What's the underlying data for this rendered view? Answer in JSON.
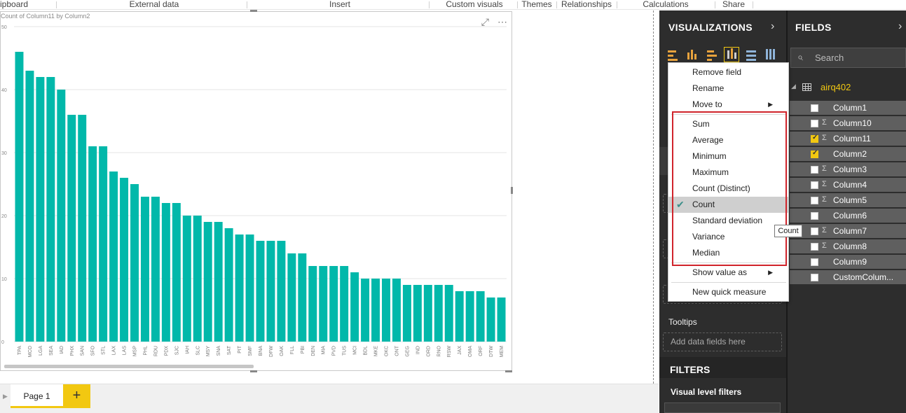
{
  "ribbon": {
    "groups": [
      "ipboard",
      "External data",
      "Insert",
      "Custom visuals",
      "Themes",
      "Relationships",
      "Calculations",
      "Share"
    ]
  },
  "visual": {
    "title": "Count of Column11 by Column2",
    "icons": [
      "focus-mode-icon",
      "more-options-icon"
    ]
  },
  "chart_data": {
    "type": "bar",
    "title": "Count of Column11 by Column2",
    "xlabel": "",
    "ylabel": "",
    "ylim": [
      0,
      50
    ],
    "yticks": [
      0,
      10,
      20,
      30,
      40,
      50
    ],
    "grid": true,
    "color": "#01b8aa",
    "categories": [
      "TPA",
      "MCO",
      "LGA",
      "SEA",
      "IAD",
      "PHX",
      "SAN",
      "SFO",
      "STL",
      "LAX",
      "LAS",
      "MSP",
      "PHL",
      "RDU",
      "PDX",
      "SJC",
      "IAH",
      "SLC",
      "MSY",
      "SNA",
      "SAT",
      "PIT",
      "SMF",
      "BNA",
      "DFW",
      "OAK",
      "FLL",
      "PBI",
      "DEN",
      "MIA",
      "PVD",
      "TUS",
      "MCI",
      "BDL",
      "MKE",
      "OKC",
      "ONT",
      "GEG",
      "IND",
      "ORD",
      "RNO",
      "RSW",
      "JAX",
      "OMA",
      "ORF",
      "DTW",
      "MEM"
    ],
    "values": [
      46,
      43,
      42,
      42,
      40,
      36,
      36,
      31,
      31,
      27,
      26,
      25,
      23,
      23,
      22,
      22,
      20,
      20,
      19,
      19,
      18,
      17,
      17,
      16,
      16,
      16,
      14,
      14,
      12,
      12,
      12,
      12,
      11,
      10,
      10,
      10,
      10,
      9,
      9,
      9,
      9,
      9,
      8,
      8,
      8,
      7,
      7
    ]
  },
  "pages": {
    "current": "Page 1",
    "add_label": "+"
  },
  "viz_pane": {
    "title": "VISUALIZATIONS",
    "tooltips_label": "Tooltips",
    "tooltips_placeholder": "Add data fields here",
    "filters_title": "FILTERS",
    "visual_level_filters": "Visual level filters"
  },
  "fields_pane": {
    "title": "FIELDS",
    "search_placeholder": "Search",
    "table_name": "airq402",
    "fields": [
      {
        "name": "Column1",
        "sigma": false,
        "checked": false
      },
      {
        "name": "Column10",
        "sigma": true,
        "checked": false
      },
      {
        "name": "Column11",
        "sigma": true,
        "checked": true
      },
      {
        "name": "Column2",
        "sigma": false,
        "checked": true
      },
      {
        "name": "Column3",
        "sigma": true,
        "checked": false
      },
      {
        "name": "Column4",
        "sigma": true,
        "checked": false
      },
      {
        "name": "Column5",
        "sigma": true,
        "checked": false
      },
      {
        "name": "Column6",
        "sigma": false,
        "checked": false
      },
      {
        "name": "Column7",
        "sigma": true,
        "checked": false
      },
      {
        "name": "Column8",
        "sigma": true,
        "checked": false
      },
      {
        "name": "Column9",
        "sigma": false,
        "checked": false
      },
      {
        "name": "CustomColum...",
        "sigma": false,
        "checked": false
      }
    ]
  },
  "context_menu": {
    "remove_field": "Remove field",
    "rename": "Rename",
    "move_to": "Move to",
    "sum": "Sum",
    "average": "Average",
    "minimum": "Minimum",
    "maximum": "Maximum",
    "count_distinct": "Count (Distinct)",
    "count": "Count",
    "standard_deviation": "Standard deviation",
    "variance": "Variance",
    "median": "Median",
    "show_value_as": "Show value as",
    "new_quick_measure": "New quick measure",
    "selected": "Count"
  },
  "tooltip_text": "Count",
  "accent_color": "#f2c811",
  "highlight_box_color": "#d0242b"
}
